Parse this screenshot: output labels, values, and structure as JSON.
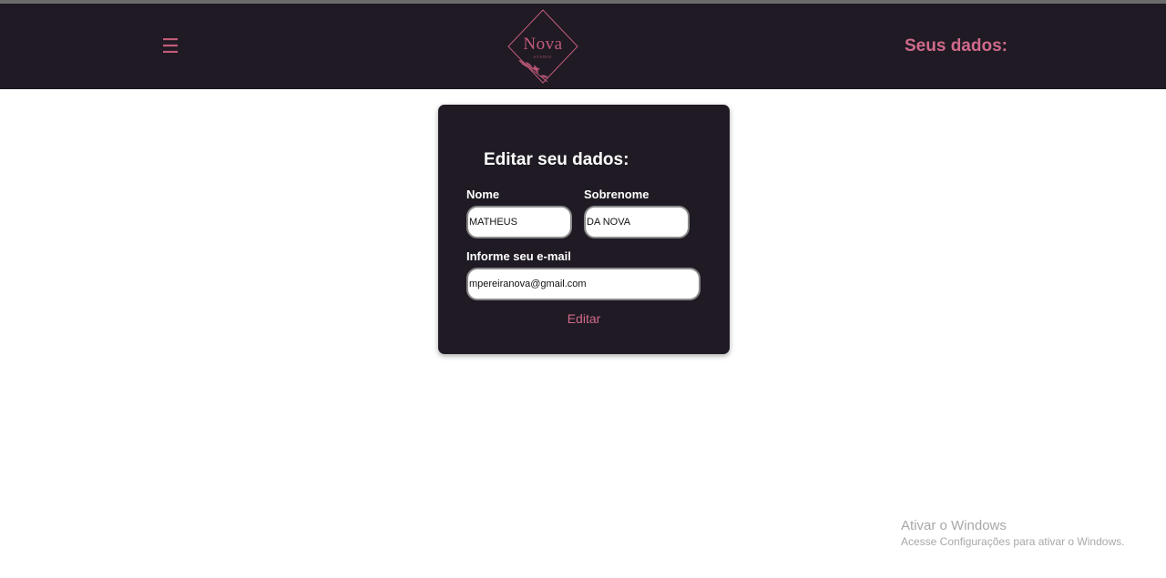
{
  "header": {
    "menu_icon": "hamburger-menu-icon",
    "menu_glyph": "☰",
    "logo_text": "Nova",
    "logo_sub": "STUDIO",
    "title": "Seus dados:"
  },
  "form": {
    "title": "Editar seu dados:",
    "first_name_label": "Nome",
    "first_name_value": "MATHEUS",
    "last_name_label": "Sobrenome",
    "last_name_value": "DA NOVA",
    "email_label": "Informe seu e-mail",
    "email_value": "mpereiranova@gmail.com",
    "submit_label": "Editar"
  },
  "watermark": {
    "title": "Ativar o Windows",
    "subtitle": "Acesse Configurações para ativar o Windows."
  },
  "colors": {
    "bar_bg": "#1f1a23",
    "accent": "#c25b7a",
    "accent_light": "#d06a8a"
  }
}
